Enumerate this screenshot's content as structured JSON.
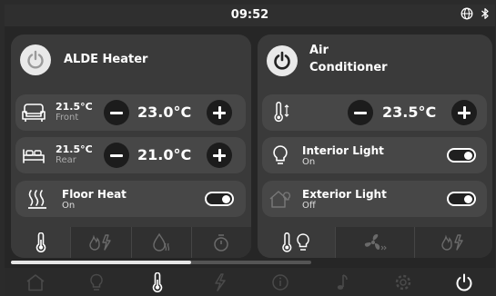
{
  "status": {
    "time": "09:52",
    "icons": [
      "globe-icon",
      "bluetooth-icon"
    ]
  },
  "heater": {
    "title": "ALDE Heater",
    "front": {
      "current": "21.5°C",
      "label": "Front",
      "setpoint": "23.0°C"
    },
    "rear": {
      "current": "21.5°C",
      "label": "Rear",
      "setpoint": "21.0°C"
    },
    "floor_heat": {
      "label": "Floor Heat",
      "state": "On"
    },
    "tabs": [
      "thermometer-icon",
      "gas-electric-icon",
      "hot-water-icon",
      "timer-icon"
    ]
  },
  "aircon": {
    "title_line1": "Air",
    "title_line2": "Conditioner",
    "setpoint": "23.5°C",
    "interior_light": {
      "label": "Interior Light",
      "state": "On"
    },
    "exterior_light": {
      "label": "Exterior Light",
      "state": "Off"
    },
    "tabs": [
      "thermometer-light-icon",
      "fan-icon",
      "gas-electric-icon"
    ]
  },
  "page_progress": 0.6,
  "nav": [
    "home-icon",
    "light-bulb-icon",
    "thermometer-icon",
    "power-bolt-icon",
    "info-icon",
    "music-note-icon",
    "settings-gear-icon",
    "power-icon"
  ],
  "colors": {
    "panel": "#3a3a3a",
    "row": "#474747",
    "screen": "#262626",
    "accent": "#ffffff"
  }
}
